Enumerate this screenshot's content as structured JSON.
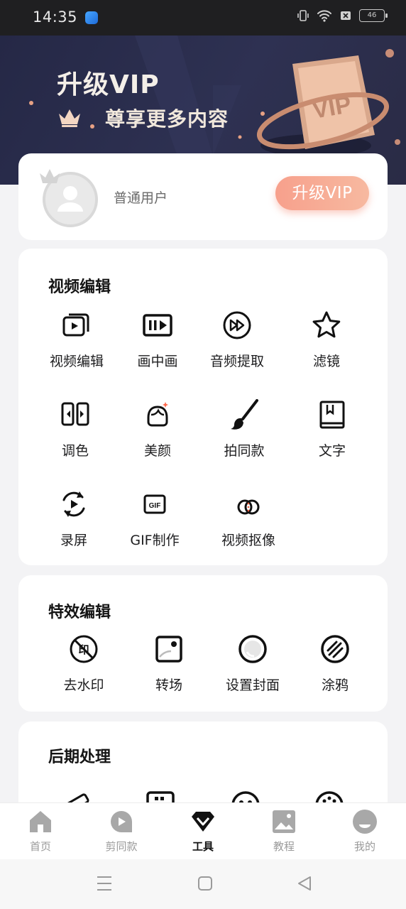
{
  "status_bar": {
    "time": "14:35",
    "battery": "46"
  },
  "banner": {
    "title": "升级VIP",
    "subtitle": "尊享更多内容",
    "card_text": "VIP"
  },
  "user": {
    "name": "普通用户",
    "upgrade_label": "升级VIP"
  },
  "sections": {
    "video_edit": {
      "title": "视频编辑",
      "tools": [
        "视频编辑",
        "画中画",
        "音频提取",
        "滤镜",
        "调色",
        "美颜",
        "拍同款",
        "文字",
        "录屏",
        "GIF制作",
        "视频抠像"
      ]
    },
    "effects_edit": {
      "title": "特效编辑",
      "tools": [
        "去水印",
        "转场",
        "设置封面",
        "涂鸦"
      ]
    },
    "post_process": {
      "title": "后期处理"
    }
  },
  "tab_bar": {
    "tabs": [
      "首页",
      "剪同款",
      "工具",
      "教程",
      "我的"
    ],
    "active_index": 2
  },
  "colors": {
    "accent": "#f7a08c",
    "banner_bg": "#2a2d4b",
    "card_bg": "#ffffff"
  }
}
